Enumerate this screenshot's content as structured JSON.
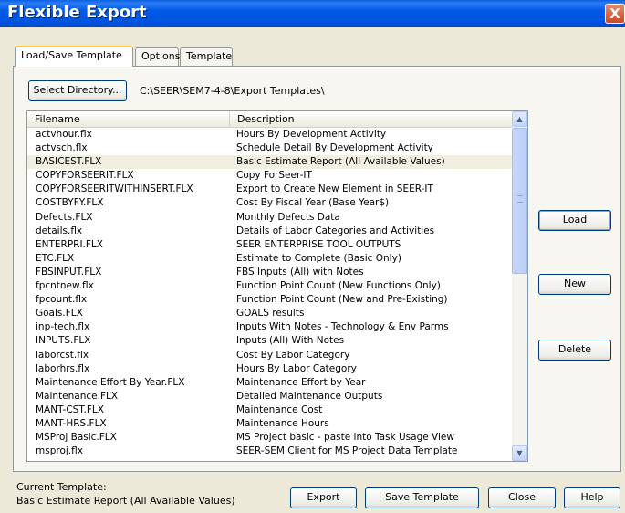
{
  "window": {
    "title": "Flexible Export",
    "close_glyph": "X"
  },
  "tabs": [
    {
      "label": "Load/Save Template",
      "active": true
    },
    {
      "label": "Options",
      "active": false
    },
    {
      "label": "Template",
      "active": false
    }
  ],
  "directory": {
    "button_label": "Select Directory...",
    "path": "C:\\SEER\\SEM7-4-8\\Export Templates\\"
  },
  "list": {
    "headers": {
      "filename": "Filename",
      "description": "Description"
    },
    "rows": [
      {
        "filename": "actvhour.flx",
        "description": "Hours By Development Activity"
      },
      {
        "filename": "actvsch.flx",
        "description": "Schedule Detail By Development Activity"
      },
      {
        "filename": "BASICEST.FLX",
        "description": "Basic Estimate Report (All Available Values)"
      },
      {
        "filename": "COPYFORSEERIT.FLX",
        "description": "Copy ForSeer-IT"
      },
      {
        "filename": "COPYFORSEERITWITHINSERT.FLX",
        "description": "Export to Create New Element in SEER-IT"
      },
      {
        "filename": "COSTBYFY.FLX",
        "description": "Cost By Fiscal Year (Base Year$)"
      },
      {
        "filename": "Defects.FLX",
        "description": "Monthly Defects Data"
      },
      {
        "filename": "details.flx",
        "description": "Details of Labor Categories and Activities"
      },
      {
        "filename": "ENTERPRI.FLX",
        "description": "SEER ENTERPRISE TOOL OUTPUTS"
      },
      {
        "filename": "ETC.FLX",
        "description": "Estimate to Complete (Basic Only)"
      },
      {
        "filename": "FBSINPUT.FLX",
        "description": "FBS Inputs (All) with Notes"
      },
      {
        "filename": "fpcntnew.flx",
        "description": "Function Point Count (New Functions Only)"
      },
      {
        "filename": "fpcount.flx",
        "description": "Function Point Count (New and Pre-Existing)"
      },
      {
        "filename": "Goals.FLX",
        "description": "GOALS results"
      },
      {
        "filename": "inp-tech.flx",
        "description": "Inputs With Notes - Technology & Env Parms"
      },
      {
        "filename": "INPUTS.FLX",
        "description": "Inputs (All) With Notes"
      },
      {
        "filename": "laborcst.flx",
        "description": "Cost By Labor Category"
      },
      {
        "filename": "laborhrs.flx",
        "description": "Hours By Labor Category"
      },
      {
        "filename": "Maintenance Effort By Year.FLX",
        "description": "Maintenance Effort by Year"
      },
      {
        "filename": "Maintenance.FLX",
        "description": "Detailed Maintenance Outputs"
      },
      {
        "filename": "MANT-CST.FLX",
        "description": "Maintenance Cost"
      },
      {
        "filename": "MANT-HRS.FLX",
        "description": "Maintenance Hours"
      },
      {
        "filename": "MSProj Basic.FLX",
        "description": "MS Project basic - paste into Task Usage View"
      },
      {
        "filename": "msproj.flx",
        "description": "SEER-SEM Client for MS Project Data Template"
      }
    ],
    "selected_index": 2
  },
  "side_buttons": {
    "load": "Load",
    "new": "New",
    "delete": "Delete"
  },
  "current_template": {
    "label": "Current Template:",
    "value": "Basic Estimate Report (All Available Values)"
  },
  "bottom_buttons": {
    "export": "Export",
    "save_template": "Save Template",
    "close": "Close",
    "help": "Help"
  },
  "colors": {
    "title_bar": "#0058E6",
    "selected_row": "#F1EEE2",
    "dialog_bg": "#ECE9D8"
  }
}
